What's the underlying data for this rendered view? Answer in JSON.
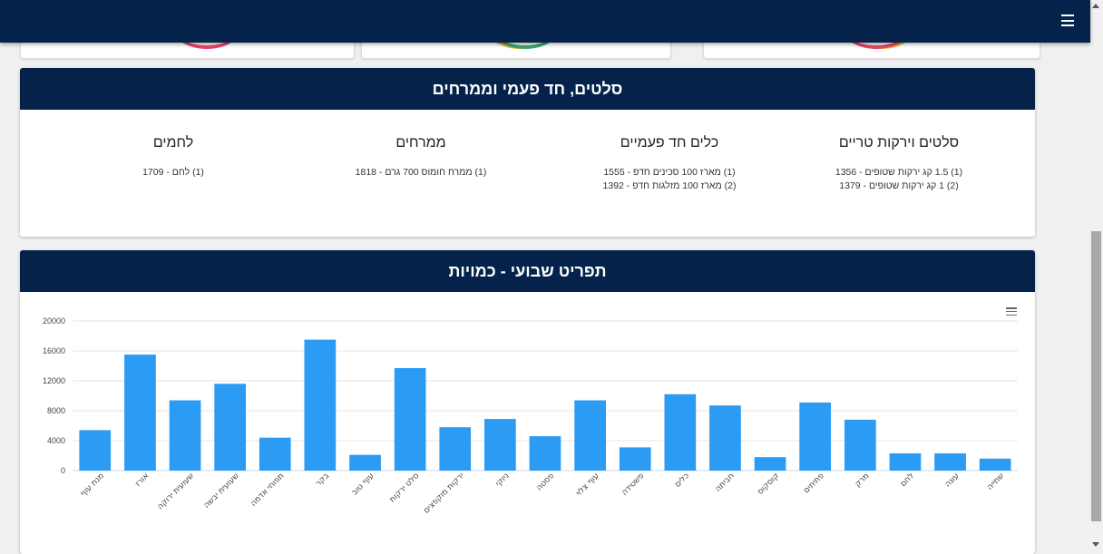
{
  "colors": {
    "navbar": "#05234a",
    "bar": "#2b9bf4",
    "grid": "#e6e6e6"
  },
  "navbar": {
    "menu_icon": "hamburger-icon"
  },
  "section_salads": {
    "title": "סלטים, חד פעמי וממרחים",
    "columns": [
      {
        "heading": "סלטים וירקות טריים",
        "lines": [
          "(1) 1.5 קג ירקות שטופים - 1356",
          "(2) 1 קג ירקות שטופים - 1379"
        ]
      },
      {
        "heading": "כלים חד פעמיים",
        "lines": [
          "(1) מארז 100 סכינים חדפ - 1555",
          "(2) מארז 100 מזלגות חדפ - 1392"
        ]
      },
      {
        "heading": "ממרחים",
        "lines": [
          "(1) ממרח חומוס 700 גרם - 1818"
        ]
      },
      {
        "heading": "לחמים",
        "lines": [
          "(1) לחם - 1709"
        ]
      }
    ]
  },
  "section_chart": {
    "title": "תפריט שבועי - כמויות",
    "menu_icon": "chart-menu-icon"
  },
  "chart_data": {
    "type": "bar",
    "ylim": [
      0,
      20000
    ],
    "yticks": [
      "0",
      "4000",
      "8000",
      "12000",
      "16000",
      "20000"
    ],
    "categories": [
      "מנת עוף",
      "אורז",
      "שעועית ירוקה",
      "שעועית יבשה",
      "תפוחי אדמה",
      "בקר",
      "עוף טוב",
      "סלט ירקות",
      "ירקות מוקפצים",
      "ניוקי",
      "פסטה",
      "עוף צלוי",
      "פשטידה",
      "כלים",
      "חביתה",
      "קוסקוס",
      "פתיתים",
      "מרק",
      "לחם",
      "עוגה",
      "שתייה"
    ],
    "values": [
      5400,
      15500,
      9400,
      11600,
      4400,
      17500,
      2100,
      13700,
      5800,
      6900,
      4600,
      9400,
      3100,
      10200,
      8700,
      1800,
      9100,
      6800,
      2300,
      2300,
      1600
    ],
    "grid": true,
    "legend": "none"
  }
}
